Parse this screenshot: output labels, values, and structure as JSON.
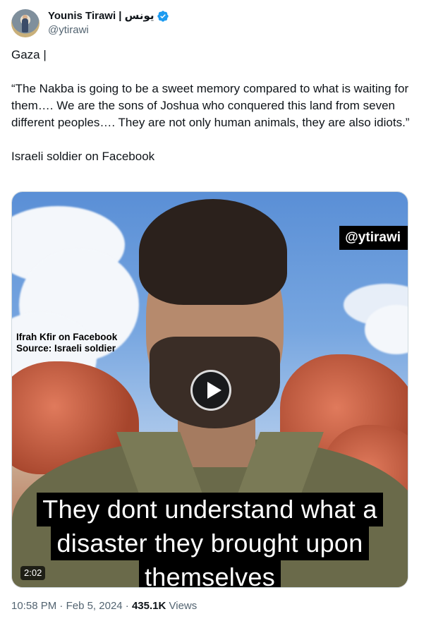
{
  "author": {
    "display_name": "Younis Tirawi | يونس",
    "handle": "@ytirawi",
    "verified": true,
    "avatar_icon": "avatar-photo-icon",
    "badge_color": "#1d9bf0"
  },
  "tweet": {
    "paragraphs": [
      "Gaza |",
      "“The Nakba is going to be a sweet memory compared to what is waiting for them…. We are the sons of Joshua who conquered this land from seven different peoples…. They are not only human animals, they are also idiots.”",
      "Israeli soldier on Facebook"
    ]
  },
  "media": {
    "watermark": "@ytirawi",
    "source_lines": [
      "Ifrah Kfir on Facebook",
      "Source: Israeli soldier"
    ],
    "subtitles": [
      "They dont understand what a",
      "disaster they brought upon",
      "themselves"
    ],
    "duration": "2:02",
    "play_icon": "play-icon"
  },
  "meta": {
    "time": "10:58 PM",
    "date": "Feb 5, 2024",
    "separator": "·",
    "views_count": "435.1K",
    "views_label": "Views"
  }
}
